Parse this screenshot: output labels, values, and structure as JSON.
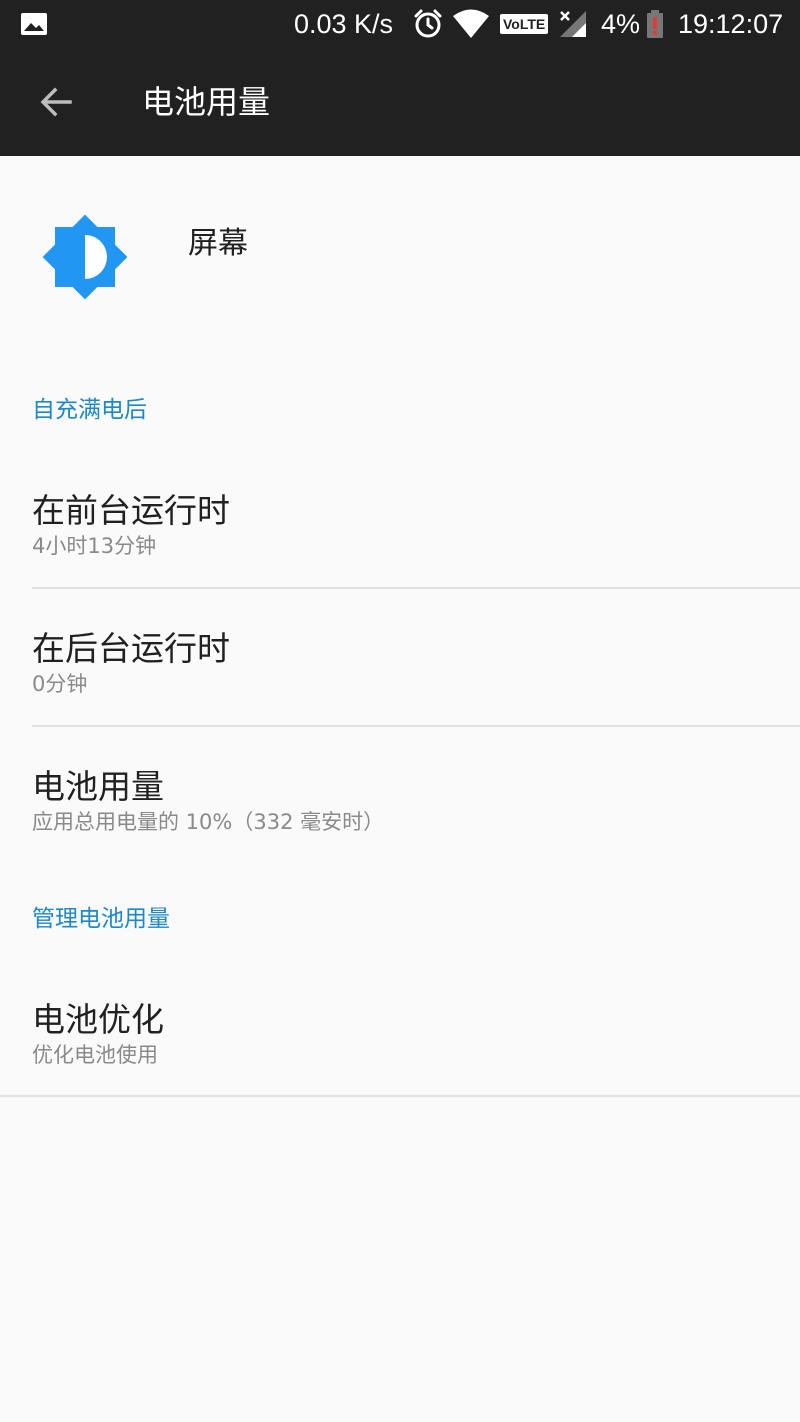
{
  "status_bar": {
    "network_speed": "0.03 K/s",
    "volte_label": "VoLTE",
    "battery_percent": "4%",
    "time": "19:12:07",
    "icons": [
      "image-icon",
      "alarm-icon",
      "wifi-icon",
      "volte-icon",
      "signal-icon",
      "battery-low-icon"
    ]
  },
  "toolbar": {
    "title": "电池用量"
  },
  "app": {
    "name": "屏幕",
    "icon_color": "#2196f3"
  },
  "sections": {
    "since_full_charge": "自充满电后",
    "manage_battery": "管理电池用量"
  },
  "items": {
    "foreground": {
      "title": "在前台运行时",
      "summary": "4小时13分钟"
    },
    "background": {
      "title": "在后台运行时",
      "summary": "0分钟"
    },
    "battery_usage": {
      "title": "电池用量",
      "summary": "应用总用电量的 10%（332 毫安时）"
    },
    "optimization": {
      "title": "电池优化",
      "summary": "优化电池使用"
    }
  },
  "colors": {
    "accent": "#1e88c8",
    "toolbar_bg": "#212121",
    "page_bg": "#fafafa",
    "battery_warning": "#e53935"
  }
}
